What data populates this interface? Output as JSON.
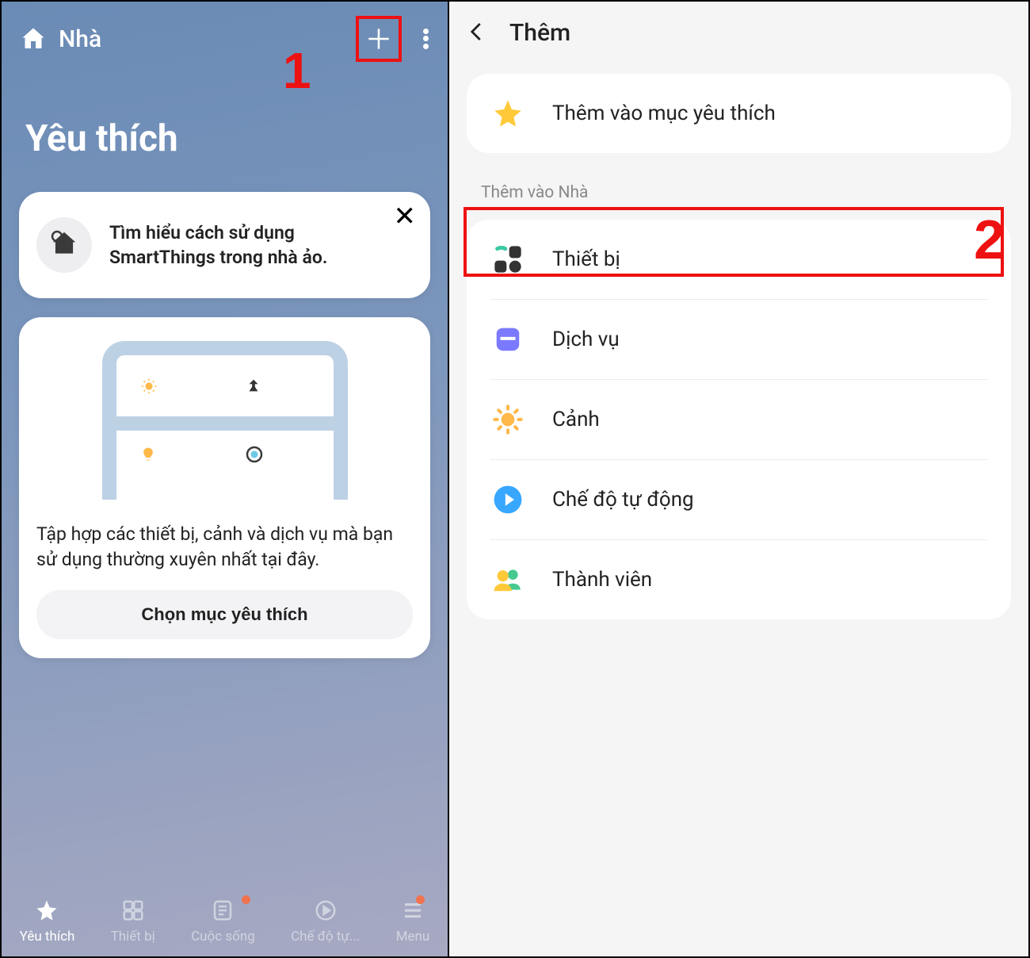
{
  "annotations": {
    "step1": "1",
    "step2": "2"
  },
  "left": {
    "headerTitle": "Nhà",
    "favTitle": "Yêu thích",
    "tip": {
      "text": "Tìm hiểu cách sử dụng SmartThings trong nhà ảo."
    },
    "dashboard": {
      "desc": "Tập hợp các thiết bị, cảnh và dịch vụ mà bạn sử dụng thường xuyên nhất tại đây.",
      "button": "Chọn mục yêu thích"
    },
    "nav": {
      "fav": "Yêu thích",
      "devices": "Thiết bị",
      "life": "Cuộc sống",
      "auto": "Chế độ tự...",
      "menu": "Menu"
    }
  },
  "right": {
    "headerTitle": "Thêm",
    "favoriteItem": "Thêm vào mục yêu thích",
    "sectionLabel": "Thêm vào Nhà",
    "items": {
      "device": "Thiết bị",
      "service": "Dịch vụ",
      "scene": "Cảnh",
      "automation": "Chế độ tự động",
      "member": "Thành viên"
    }
  }
}
